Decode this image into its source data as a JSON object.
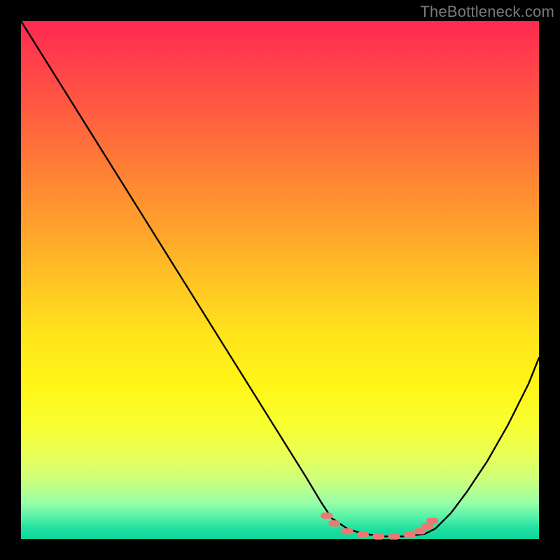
{
  "watermark": "TheBottleneck.com",
  "colors": {
    "frame": "#000000",
    "curve": "#000000",
    "highlight": "#e97a72"
  },
  "chart_data": {
    "type": "line",
    "title": "",
    "xlabel": "",
    "ylabel": "",
    "xlim": [
      0,
      100
    ],
    "ylim": [
      0,
      100
    ],
    "grid": false,
    "series": [
      {
        "name": "bottleneck-curve",
        "x": [
          0,
          5,
          10,
          15,
          20,
          25,
          30,
          35,
          40,
          45,
          50,
          55,
          58,
          60,
          63,
          66,
          70,
          74,
          78,
          80,
          83,
          86,
          90,
          94,
          98,
          100
        ],
        "y": [
          100,
          92,
          84,
          76,
          68,
          60,
          52,
          44,
          36,
          28,
          20,
          12,
          7,
          4,
          2,
          1,
          0.5,
          0.5,
          1,
          2,
          5,
          9,
          15,
          22,
          30,
          35
        ]
      }
    ],
    "annotations": [
      {
        "name": "optimal-zone-highlight",
        "type": "scatter",
        "color": "#e97a72",
        "x": [
          59,
          60.5,
          63,
          66,
          69,
          72,
          75,
          77,
          78.5,
          79.4
        ],
        "y": [
          4.5,
          3.0,
          1.5,
          0.8,
          0.5,
          0.5,
          0.8,
          1.5,
          2.5,
          3.5
        ]
      }
    ],
    "background": {
      "type": "gradient",
      "direction": "vertical",
      "stops": [
        {
          "pos": 0,
          "color": "#ff2951"
        },
        {
          "pos": 50,
          "color": "#ffc324"
        },
        {
          "pos": 80,
          "color": "#f8ff30"
        },
        {
          "pos": 100,
          "color": "#0fd49a"
        }
      ]
    }
  }
}
